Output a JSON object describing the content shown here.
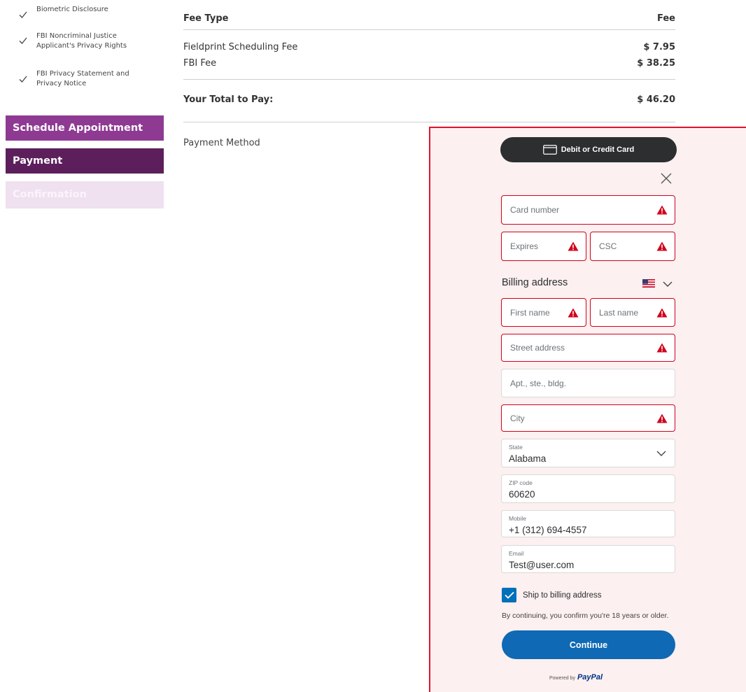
{
  "sidebar": {
    "items": [
      {
        "label": "Biometric Disclosure"
      },
      {
        "label": "FBI Noncriminal Justice",
        "label2": "Applicant's Privacy Rights"
      },
      {
        "label": "FBI Privacy Statement and",
        "label2": "Privacy Notice"
      }
    ],
    "steps": [
      "Schedule Appointment",
      "Payment",
      "Confirmation"
    ]
  },
  "fees": {
    "header_type": "Fee Type",
    "header_fee": "Fee",
    "rows": [
      {
        "name": "Fieldprint Scheduling Fee",
        "amount": "$ 7.95"
      },
      {
        "name": "FBI Fee",
        "amount": "$ 38.25"
      }
    ],
    "total_label": "Your Total to Pay:",
    "total_amount": "$ 46.20",
    "payment_method_label": "Payment Method"
  },
  "paypal": {
    "card_button": "Debit or Credit Card",
    "card_number": "Card number",
    "expires": "Expires",
    "csc": "CSC",
    "billing_title": "Billing address",
    "first_name": "First name",
    "last_name": "Last name",
    "street": "Street address",
    "apt": "Apt., ste., bldg.",
    "city": "City",
    "state_label": "State",
    "state_value": "Alabama",
    "zip_label": "ZIP code",
    "zip_value": "60620",
    "mobile_label": "Mobile",
    "mobile_value": "+1  (312) 694-4557",
    "email_label": "Email",
    "email_value": "Test@user.com",
    "ship_label": "Ship to billing address",
    "ship_checked": true,
    "age_note": "By continuing, you confirm you're 18 years or older.",
    "continue": "Continue",
    "powered_by": "Powered by",
    "brand": "PayPal"
  },
  "colors": {
    "error_border": "#d0021b",
    "highlight": "#e0142b",
    "paypal_blue": "#0f69b4",
    "step_schedule": "#8e3a93",
    "step_payment": "#5c1f5c"
  }
}
